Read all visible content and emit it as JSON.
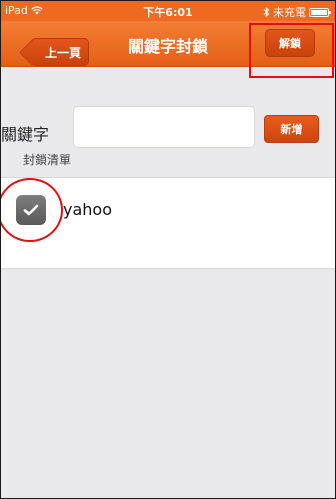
{
  "status_bar": {
    "device": "iPad",
    "time": "下午6:01",
    "battery_text": "未充電",
    "wifi_icon": "wifi-icon",
    "bluetooth_icon": "bluetooth-icon"
  },
  "nav": {
    "back_label": "上一頁",
    "title": "關鍵字封鎖",
    "unlock_label": "解鎖"
  },
  "keyword": {
    "label": "關鍵字",
    "input_value": "",
    "add_label": "新增"
  },
  "block_list": {
    "header": "封鎖清單",
    "items": [
      {
        "text": "yahoo",
        "checked": true
      }
    ]
  },
  "colors": {
    "accent": "#ee6a22",
    "annotation": "#e31010"
  }
}
